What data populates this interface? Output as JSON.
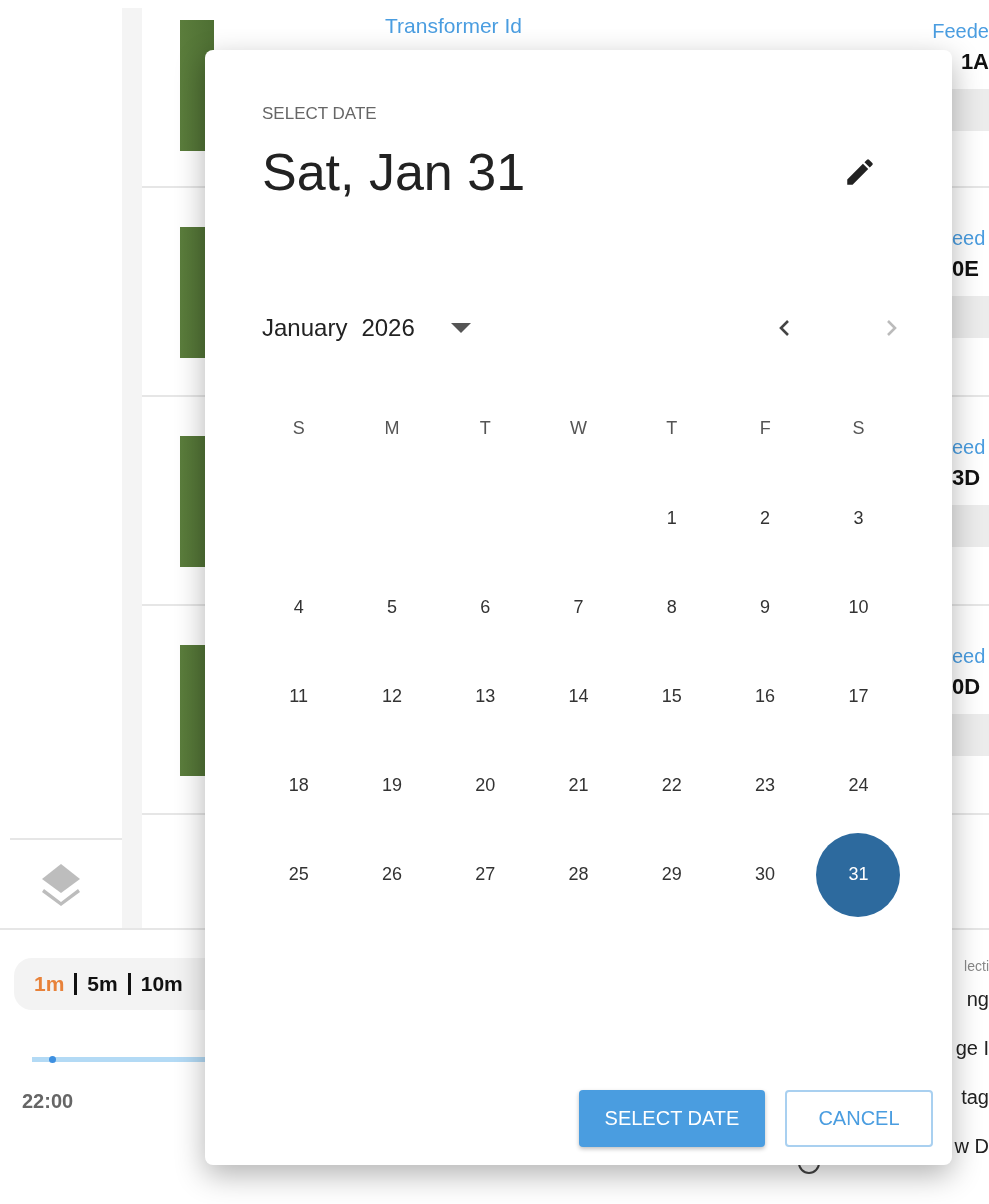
{
  "background": {
    "rows": [
      {
        "transformer_label": "Transformer Id",
        "feeder_label": "Feede",
        "feeder_value": "1A"
      },
      {
        "feeder_label": "eed",
        "feeder_value": "0E"
      },
      {
        "feeder_label": "eed",
        "feeder_value": "3D"
      },
      {
        "feeder_label": "eed",
        "feeder_value": "0D"
      }
    ],
    "intervals": [
      {
        "label": "1m",
        "selected": true
      },
      {
        "label": "5m",
        "selected": false
      },
      {
        "label": "10m",
        "selected": false
      }
    ],
    "timeline": {
      "level": 0.02,
      "time_label": "22:00"
    },
    "side_texts": [
      {
        "kind": "caption",
        "text": "lecti"
      },
      {
        "kind": "item",
        "text": "ng"
      },
      {
        "kind": "item",
        "text": "ge I"
      },
      {
        "kind": "item",
        "text": "tag"
      },
      {
        "kind": "item",
        "text": "w D"
      }
    ]
  },
  "date_dialog": {
    "header": "SELECT DATE",
    "selected_date": "Sat, Jan 31",
    "month": "January",
    "year": "2026",
    "prev_button": {
      "disabled": false
    },
    "next_button": {
      "disabled": true
    },
    "weekdays": [
      "S",
      "M",
      "T",
      "W",
      "T",
      "F",
      "S"
    ],
    "weeks": [
      [
        {
          "kind": "blank"
        },
        {
          "kind": "blank"
        },
        {
          "kind": "blank"
        },
        {
          "kind": "blank"
        },
        {
          "kind": "day",
          "label": "1",
          "selected": false
        },
        {
          "kind": "day",
          "label": "2",
          "selected": false
        },
        {
          "kind": "day",
          "label": "3",
          "selected": false
        }
      ],
      [
        {
          "kind": "day",
          "label": "4",
          "selected": false
        },
        {
          "kind": "day",
          "label": "5",
          "selected": false
        },
        {
          "kind": "day",
          "label": "6",
          "selected": false
        },
        {
          "kind": "day",
          "label": "7",
          "selected": false
        },
        {
          "kind": "day",
          "label": "8",
          "selected": false
        },
        {
          "kind": "day",
          "label": "9",
          "selected": false
        },
        {
          "kind": "day",
          "label": "10",
          "selected": false
        }
      ],
      [
        {
          "kind": "day",
          "label": "11",
          "selected": false
        },
        {
          "kind": "day",
          "label": "12",
          "selected": false
        },
        {
          "kind": "day",
          "label": "13",
          "selected": false
        },
        {
          "kind": "day",
          "label": "14",
          "selected": false
        },
        {
          "kind": "day",
          "label": "15",
          "selected": false
        },
        {
          "kind": "day",
          "label": "16",
          "selected": false
        },
        {
          "kind": "day",
          "label": "17",
          "selected": false
        }
      ],
      [
        {
          "kind": "day",
          "label": "18",
          "selected": false
        },
        {
          "kind": "day",
          "label": "19",
          "selected": false
        },
        {
          "kind": "day",
          "label": "20",
          "selected": false
        },
        {
          "kind": "day",
          "label": "21",
          "selected": false
        },
        {
          "kind": "day",
          "label": "22",
          "selected": false
        },
        {
          "kind": "day",
          "label": "23",
          "selected": false
        },
        {
          "kind": "day",
          "label": "24",
          "selected": false
        }
      ],
      [
        {
          "kind": "day",
          "label": "25",
          "selected": false
        },
        {
          "kind": "day",
          "label": "26",
          "selected": false
        },
        {
          "kind": "day",
          "label": "27",
          "selected": false
        },
        {
          "kind": "day",
          "label": "28",
          "selected": false
        },
        {
          "kind": "day",
          "label": "29",
          "selected": false
        },
        {
          "kind": "day",
          "label": "30",
          "selected": false
        },
        {
          "kind": "day",
          "label": "31",
          "selected": true
        }
      ]
    ],
    "buttons": [
      {
        "kind": "primary",
        "label": "SELECT DATE"
      },
      {
        "kind": "outlined",
        "label": "CANCEL"
      }
    ]
  }
}
